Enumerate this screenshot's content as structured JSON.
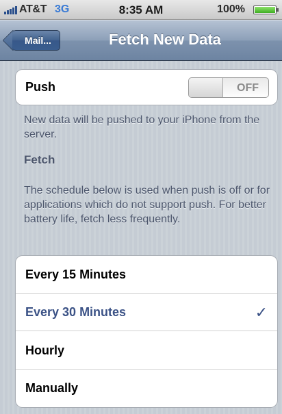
{
  "status_bar": {
    "carrier": "AT&T",
    "network": "3G",
    "time": "8:35 AM",
    "battery": "100%",
    "accent_network": "#3a7bd5",
    "battery_color": "#3fae22"
  },
  "nav": {
    "back_label": "Mail...",
    "title": "Fetch New Data"
  },
  "push": {
    "label": "Push",
    "toggle_value": "OFF",
    "note": "New data will be pushed to your iPhone from the server."
  },
  "fetch": {
    "title": "Fetch",
    "note": "The schedule below is used when push is off or for applications which do not support push. For better battery life, fetch less frequently."
  },
  "options": [
    {
      "label": "Every 15 Minutes",
      "selected": false
    },
    {
      "label": "Every 30 Minutes",
      "selected": true
    },
    {
      "label": "Hourly",
      "selected": false
    },
    {
      "label": "Manually",
      "selected": false
    }
  ],
  "checkmark": "✓",
  "colors": {
    "selected_text": "#3b5286",
    "background": "#c5ccd4"
  }
}
